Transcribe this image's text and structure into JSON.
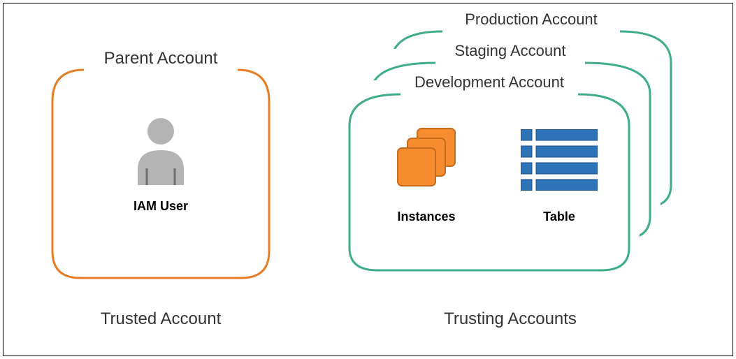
{
  "left": {
    "card_title": "Parent Account",
    "icon_label": "IAM User",
    "footer_label": "Trusted Account",
    "border_color": "#E87E24"
  },
  "right": {
    "cards": [
      {
        "title": "Production Account"
      },
      {
        "title": "Staging Account"
      },
      {
        "title": "Development Account"
      }
    ],
    "instances_label": "Instances",
    "table_label": "Table",
    "footer_label": "Trusting Accounts",
    "border_color": "#3FAE84"
  },
  "colors": {
    "orange_fill": "#F58C30",
    "orange_stroke": "#C76B1D",
    "blue_fill": "#2E73B8",
    "blue_stroke": "#1A4C80",
    "gray_fill": "#B4B4B4",
    "gray_stroke": "#6F6F6F"
  }
}
